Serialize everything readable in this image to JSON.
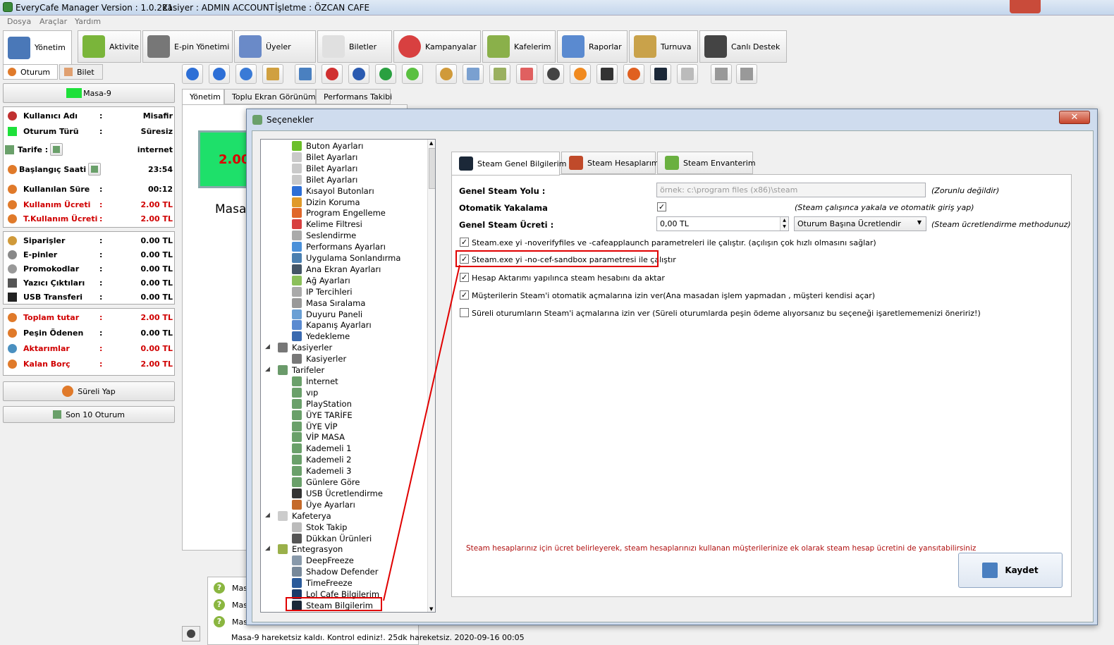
{
  "app": {
    "title": "EveryCafe Manager Version : 1.0.221",
    "cashier": "Kasiyer : ADMIN ACCOUNT",
    "business": "İşletme : ÖZCAN CAFE"
  },
  "menu": [
    "Dosya",
    "Araçlar",
    "Yardım"
  ],
  "main_tabs": [
    "Yönetim",
    "Aktivite",
    "E-pin Yönetimi",
    "Üyeler",
    "Biletler",
    "Kampanyalar",
    "Kafelerim",
    "Raporlar",
    "Turnuva",
    "Canlı Destek"
  ],
  "left": {
    "tabs": [
      "Oturum",
      "Bilet"
    ],
    "table_button": "Masa-9",
    "session": [
      {
        "label": "Kullanıcı Adı",
        "value": "Misafir",
        "red": false
      },
      {
        "label": "Oturum Türü",
        "value": "Süresiz",
        "red": false
      },
      {
        "label": "Tarife :",
        "value": "internet",
        "red": false
      },
      {
        "label": "Başlangıç Saati :",
        "value": "23:54",
        "red": false
      },
      {
        "label": "Kullanılan Süre",
        "value": "00:12",
        "red": false
      },
      {
        "label": "Kullanım Ücreti",
        "value": "2.00 TL",
        "red": true
      },
      {
        "label": "T.Kullanım Ücreti",
        "value": "2.00 TL",
        "red": true
      }
    ],
    "orders": [
      {
        "label": "Siparişler",
        "value": "0.00 TL"
      },
      {
        "label": "E-pinler",
        "value": "0.00 TL"
      },
      {
        "label": "Promokodlar",
        "value": "0.00 TL"
      },
      {
        "label": "Yazıcı Çıktıları",
        "value": "0.00 TL"
      },
      {
        "label": "USB Transferi",
        "value": "0.00 TL"
      }
    ],
    "totals": [
      {
        "label": "Toplam tutar",
        "value": "2.00 TL"
      },
      {
        "label": "Peşin Ödenen",
        "value": "0.00 TL"
      },
      {
        "label": "Aktarımlar",
        "value": "0.00 TL"
      },
      {
        "label": "Kalan Borç",
        "value": "2.00 TL"
      }
    ],
    "colon": ":",
    "timed_button": "Süreli Yap",
    "last10_button": "Son 10 Oturum"
  },
  "center": {
    "tabs": [
      "Yönetim",
      "Toplu Ekran Görünümü",
      "Performans Takibi"
    ],
    "price": "2.00",
    "masa": "Masa"
  },
  "log": {
    "rows": [
      "Mas",
      "Mas",
      "Mas"
    ],
    "bottom": "Masa-9 hareketsiz kaldı. Kontrol ediniz!. 25dk hareketsiz. 2020-09-16 00:05"
  },
  "dialog": {
    "title": "Seçenekler",
    "close": "✕",
    "tree": [
      {
        "label": "Buton Ayarları",
        "level": 1,
        "color": "#6bbf2a"
      },
      {
        "label": "Bilet Ayarları",
        "level": 1,
        "color": "#c9c9c9"
      },
      {
        "label": "Bilet Ayarları",
        "level": 1,
        "color": "#c9c9c9"
      },
      {
        "label": "Bilet Ayarları",
        "level": 1,
        "color": "#c9c9c9"
      },
      {
        "label": "Kısayol Butonları",
        "level": 1,
        "color": "#2d6fd6"
      },
      {
        "label": "Dizin Koruma",
        "level": 1,
        "color": "#e09a2a"
      },
      {
        "label": "Program Engelleme",
        "level": 1,
        "color": "#e0672a"
      },
      {
        "label": "Kelime Filtresi",
        "level": 1,
        "color": "#d84040"
      },
      {
        "label": "Seslendirme",
        "level": 1,
        "color": "#aaaaaa"
      },
      {
        "label": "Performans Ayarları",
        "level": 1,
        "color": "#4a90d9"
      },
      {
        "label": "Uygulama Sonlandırma",
        "level": 1,
        "color": "#4a7fb0"
      },
      {
        "label": "Ana Ekran Ayarları",
        "level": 1,
        "color": "#445566"
      },
      {
        "label": "Ağ Ayarları",
        "level": 1,
        "color": "#8bbf5a"
      },
      {
        "label": "IP Tercihleri",
        "level": 1,
        "color": "#aaaaaa"
      },
      {
        "label": "Masa Sıralama",
        "level": 1,
        "color": "#999999"
      },
      {
        "label": "Duyuru Paneli",
        "level": 1,
        "color": "#6a9fd4"
      },
      {
        "label": "Kapanış Ayarları",
        "level": 1,
        "color": "#5a8ad0"
      },
      {
        "label": "Yedekleme",
        "level": 1,
        "color": "#3a6ab0"
      },
      {
        "label": "Kasiyerler",
        "level": 0,
        "color": "#777777",
        "exp": "◢"
      },
      {
        "label": "Kasiyerler",
        "level": 1,
        "color": "#777777"
      },
      {
        "label": "Tarifeler",
        "level": 0,
        "color": "#6a9a6a",
        "exp": "◢"
      },
      {
        "label": "İnternet",
        "level": 1,
        "color": "#6aa06a"
      },
      {
        "label": "vıp",
        "level": 1,
        "color": "#6aa06a"
      },
      {
        "label": "PlayStation",
        "level": 1,
        "color": "#6aa06a"
      },
      {
        "label": "ÜYE TARİFE",
        "level": 1,
        "color": "#6aa06a"
      },
      {
        "label": "ÜYE VİP",
        "level": 1,
        "color": "#6aa06a"
      },
      {
        "label": "VİP MASA",
        "level": 1,
        "color": "#6aa06a"
      },
      {
        "label": "Kademeli 1",
        "level": 1,
        "color": "#6aa06a"
      },
      {
        "label": "Kademeli 2",
        "level": 1,
        "color": "#6aa06a"
      },
      {
        "label": "Kademeli 3",
        "level": 1,
        "color": "#6aa06a"
      },
      {
        "label": "Günlere Göre",
        "level": 1,
        "color": "#6aa06a"
      },
      {
        "label": "USB Ücretlendirme",
        "level": 1,
        "color": "#333333"
      },
      {
        "label": "Üye Ayarları",
        "level": 1,
        "color": "#c56a2a"
      },
      {
        "label": "Kafeterya",
        "level": 0,
        "color": "#cccccc",
        "exp": "◢"
      },
      {
        "label": "Stok Takip",
        "level": 1,
        "color": "#bbbbbb"
      },
      {
        "label": "Dükkan Ürünleri",
        "level": 1,
        "color": "#555555"
      },
      {
        "label": "Entegrasyon",
        "level": 0,
        "color": "#9ab04a",
        "exp": "◢"
      },
      {
        "label": "DeepFreeze",
        "level": 1,
        "color": "#8899aa"
      },
      {
        "label": "Shadow Defender",
        "level": 1,
        "color": "#778899"
      },
      {
        "label": "TimeFreeze",
        "level": 1,
        "color": "#2a5a9a"
      },
      {
        "label": "Lol Cafe Bilgilerim",
        "level": 1,
        "color": "#1a3a6a"
      },
      {
        "label": "Steam Bilgilerim",
        "level": 1,
        "color": "#1b2838"
      }
    ],
    "right_tabs": [
      "Steam Genel Bilgilerim",
      "Steam Hesaplarım",
      "Steam Envanterim"
    ],
    "fields": {
      "path_label": "Genel Steam Yolu :",
      "path_placeholder": "örnek: c:\\program files (x86)\\steam",
      "path_hint": "(Zorunlu değildir)",
      "auto_label": "Otomatik Yakalama",
      "auto_hint": "(Steam çalışınca yakala ve otomatik giriş yap)",
      "fee_label": "Genel Steam Ücreti :",
      "fee_value": "0,00 TL",
      "fee_method": "Oturum Başına Ücretlendir",
      "fee_hint": "(Steam ücretlendirme methodunuz)"
    },
    "options": [
      {
        "label": "Steam.exe yi -noverifyfiles ve -cafeapplaunch parametreleri ile çalıştır. (açılışın çok hızlı olmasını sağlar)",
        "checked": true
      },
      {
        "label": "Steam.exe yi -no-cef-sandbox parametresi ile çalıştır",
        "checked": true
      },
      {
        "label": "Hesap Aktarımı yapılınca steam hesabını da aktar",
        "checked": true
      },
      {
        "label": "Müşterilerin Steam'i otomatik açmalarına izin ver(Ana masadan işlem yapmadan , müşteri kendisi açar)",
        "checked": true
      },
      {
        "label": "Süreli oturumların Steam'i açmalarına izin ver (Süreli oturumlarda peşin ödeme alıyorsanız bu seçeneği işaretlememenizi öneririz!)",
        "checked": false
      }
    ],
    "check": "✓",
    "note": "Steam hesaplarınız için ücret belirleyerek, steam hesaplarınızı kullanan müşterilerinize ek olarak steam hesap ücretini de yansıtabilirsiniz",
    "save": "Kaydet"
  }
}
